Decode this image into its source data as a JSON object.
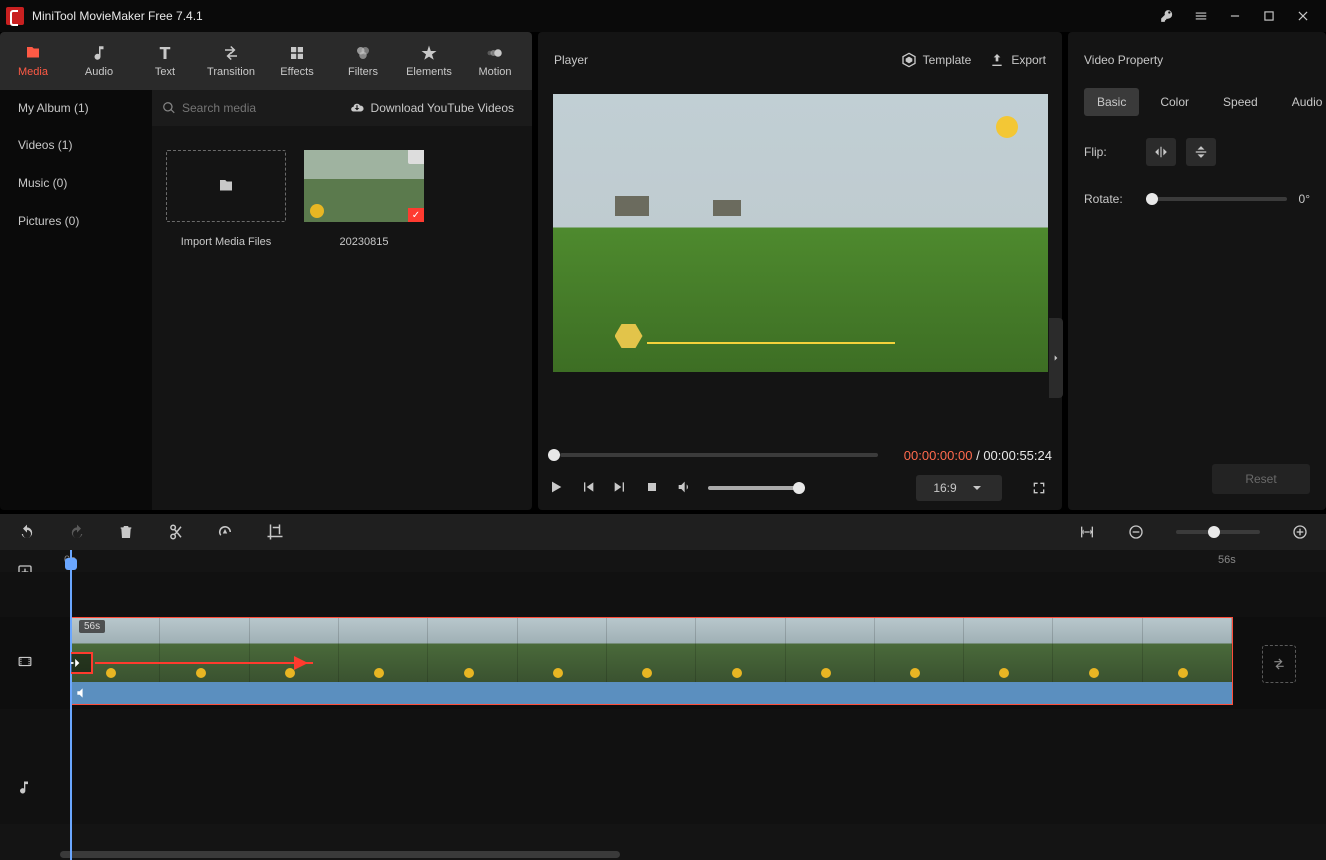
{
  "app": {
    "title": "MiniTool MovieMaker Free 7.4.1"
  },
  "main_tabs": [
    "Media",
    "Audio",
    "Text",
    "Transition",
    "Effects",
    "Filters",
    "Elements",
    "Motion"
  ],
  "main_tab_active": 0,
  "media": {
    "album_label": "My Album (1)",
    "search_placeholder": "Search media",
    "download_label": "Download YouTube Videos",
    "side_items": [
      "Videos (1)",
      "Music (0)",
      "Pictures (0)"
    ],
    "import_label": "Import Media Files",
    "clip_name": "20230815"
  },
  "player": {
    "title": "Player",
    "template_label": "Template",
    "export_label": "Export",
    "current_time": "00:00:00:00",
    "total_time": "00:00:55:24",
    "aspect": "16:9"
  },
  "property": {
    "title": "Video Property",
    "tabs": [
      "Basic",
      "Color",
      "Speed",
      "Audio"
    ],
    "tab_active": 0,
    "flip_label": "Flip:",
    "rotate_label": "Rotate:",
    "rotate_value": "0°",
    "reset_label": "Reset"
  },
  "timeline": {
    "ruler_start": "0s",
    "ruler_end": "56s",
    "clip_length": "56s"
  }
}
